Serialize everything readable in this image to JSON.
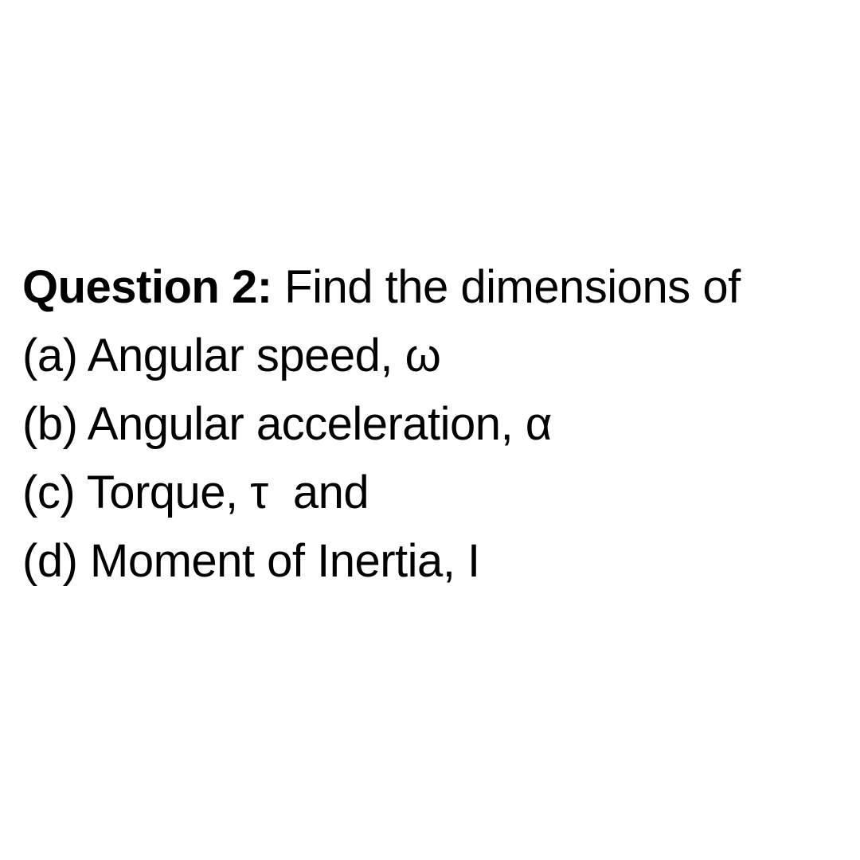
{
  "question": {
    "label": "Question 2:",
    "prompt": " Find the dimensions of",
    "parts": [
      "(a) Angular speed, ω",
      "(b) Angular acceleration, α",
      "(c) Torque, τ  and",
      "(d) Moment of Inertia, I"
    ]
  }
}
